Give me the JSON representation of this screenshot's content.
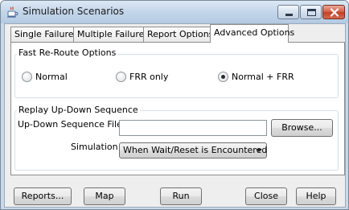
{
  "window": {
    "title": "Simulation Scenarios",
    "controls": {
      "minimize_icon": "minimize-icon",
      "maximize_icon": "maximize-icon",
      "close_icon": "close-icon"
    }
  },
  "tabs": [
    {
      "label": "Single Failure",
      "active": false
    },
    {
      "label": "Multiple Failures",
      "active": false
    },
    {
      "label": "Report Options",
      "active": false
    },
    {
      "label": "Advanced Options",
      "active": true
    }
  ],
  "frr": {
    "title": "Fast Re-Route Options",
    "options": [
      {
        "label": "Normal",
        "selected": false
      },
      {
        "label": "FRR only",
        "selected": false
      },
      {
        "label": "Normal + FRR",
        "selected": true
      }
    ]
  },
  "replay": {
    "title": "Replay Up-Down Sequence",
    "file_label": "Up-Down Sequence File:",
    "file_value": "",
    "browse_label": "Browse...",
    "simulation_label": "Simulation:",
    "simulation_value": "When Wait/Reset is Encountered"
  },
  "footer": {
    "reports_label": "Reports...",
    "map_label": "Map",
    "run_label": "Run",
    "close_label": "Close",
    "help_label": "Help"
  },
  "colors": {
    "title_bar": "#c3d6ea",
    "close_button": "#c2412a",
    "client_background": "#eeeeee"
  }
}
